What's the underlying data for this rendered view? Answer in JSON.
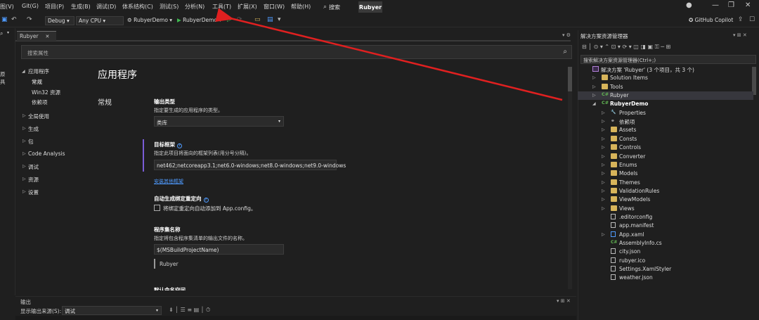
{
  "menubar": {
    "items": [
      "图(V)",
      "Git(G)",
      "项目(P)",
      "生成(B)",
      "调试(D)",
      "体系结构(C)",
      "测试(S)",
      "分析(N)",
      "工具(T)",
      "扩展(X)",
      "窗口(W)",
      "帮助(H)"
    ],
    "search_label": "搜索",
    "project_name": "Rubyer",
    "copilot_label": "GitHub Copilot"
  },
  "toolbar": {
    "config": "Debug",
    "platform": "Any CPU",
    "startup_project": "RubyerDemo",
    "run_target": "RubyerDemo"
  },
  "left_strip": {
    "labels": [
      "原",
      "工",
      "具"
    ]
  },
  "doc_tab": {
    "label": "Rubyer"
  },
  "properties": {
    "search_placeholder": "搜索属性",
    "nav": [
      {
        "label": "应用程序",
        "expanded": true
      },
      {
        "label": "常规"
      },
      {
        "label": "Win32 资源"
      },
      {
        "label": "依赖项"
      },
      {
        "label": "全局使用"
      },
      {
        "label": "生成"
      },
      {
        "label": "包"
      },
      {
        "label": "Code Analysis"
      },
      {
        "label": "调试"
      },
      {
        "label": "资源"
      },
      {
        "label": "设置"
      }
    ],
    "page_title": "应用程序",
    "section": "常规",
    "output_type": {
      "label": "输出类型",
      "desc": "指定要生成的应用程序的类型。",
      "value": "类库"
    },
    "target_framework": {
      "label": "目标框架",
      "desc": "指定此项目将面向的框架列表(用分号分隔)。",
      "value": "net462;netcoreapp3.1;net6.0-windows;net8.0-windows;net9.0-windows",
      "link": "安装其他框架"
    },
    "auto_redirect": {
      "label": "自动生成绑定重定向",
      "checkbox_label": "将绑定重定向自动添加到 App.config。"
    },
    "assembly_name": {
      "label": "程序集名称",
      "desc": "指定将包含程序集清单的输出文件的名称。",
      "value": "$(MSBuildProjectName)",
      "evaluated": "Rubyer"
    },
    "default_namespace_label": "默认命名空间"
  },
  "output": {
    "title": "输出",
    "source_label": "显示输出来源(S):",
    "source_value": "调试"
  },
  "solution_explorer": {
    "title": "解决方案资源管理器",
    "search_placeholder": "搜索解决方案资源管理器(Ctrl+;)",
    "items": [
      {
        "label": "解决方案 'Rubyer' (3 个项目，共 3 个)",
        "icon": "solution-icon",
        "level": 0
      },
      {
        "label": "Solution Items",
        "icon": "folder-icon",
        "level": 1
      },
      {
        "label": "Tools",
        "icon": "folder-icon",
        "level": 1
      },
      {
        "label": "Rubyer",
        "icon": "csproj-icon",
        "level": 1
      },
      {
        "label": "RubyerDemo",
        "icon": "csproj-icon",
        "level": 1,
        "bold": true
      },
      {
        "label": "Properties",
        "icon": "properties-icon",
        "level": 2
      },
      {
        "label": "依赖项",
        "icon": "dependencies-icon",
        "level": 2
      },
      {
        "label": "Assets",
        "icon": "folder-icon",
        "level": 2
      },
      {
        "label": "Consts",
        "icon": "folder-icon",
        "level": 2
      },
      {
        "label": "Controls",
        "icon": "folder-icon",
        "level": 2
      },
      {
        "label": "Converter",
        "icon": "folder-icon",
        "level": 2
      },
      {
        "label": "Enums",
        "icon": "folder-icon",
        "level": 2
      },
      {
        "label": "Models",
        "icon": "folder-icon",
        "level": 2
      },
      {
        "label": "Themes",
        "icon": "folder-icon",
        "level": 2
      },
      {
        "label": "ValidationRules",
        "icon": "folder-icon",
        "level": 2
      },
      {
        "label": "ViewModels",
        "icon": "folder-icon",
        "level": 2
      },
      {
        "label": "Views",
        "icon": "folder-icon",
        "level": 2
      },
      {
        "label": ".editorconfig",
        "icon": "file-icon",
        "level": 2
      },
      {
        "label": "app.manifest",
        "icon": "file-icon",
        "level": 2
      },
      {
        "label": "App.xaml",
        "icon": "xaml-icon",
        "level": 2
      },
      {
        "label": "AssemblyInfo.cs",
        "icon": "cs-icon",
        "level": 2
      },
      {
        "label": "city.json",
        "icon": "file-icon",
        "level": 2
      },
      {
        "label": "rubyer.ico",
        "icon": "file-icon",
        "level": 2
      },
      {
        "label": "Settings.XamlStyler",
        "icon": "file-icon",
        "level": 2
      },
      {
        "label": "weather.json",
        "icon": "file-icon",
        "level": 2
      }
    ]
  },
  "colors": {
    "background": "#1f1f1f",
    "accent_link": "#4f9bff",
    "annotation_arrow": "#e02020",
    "run_green": "#3fb950"
  }
}
